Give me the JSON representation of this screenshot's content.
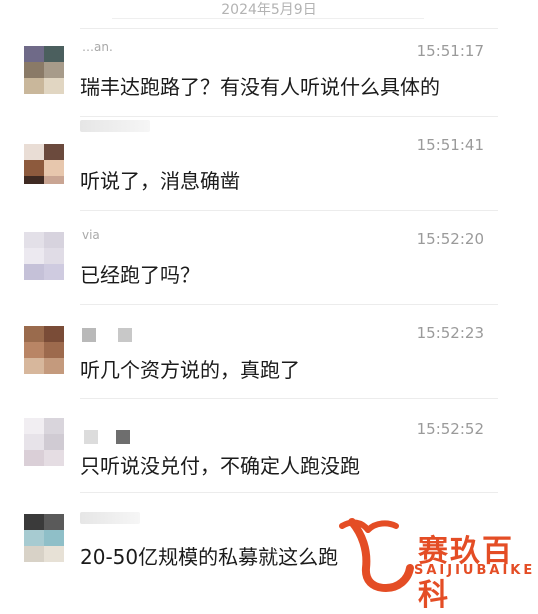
{
  "chat": {
    "date": "2024年5月9日",
    "messages": [
      {
        "name": "…an.",
        "time": "15:51:17",
        "text": "瑞丰达跑路了？有没有人听说什么具体的"
      },
      {
        "name": "",
        "time": "15:51:41",
        "text": "听说了，消息确凿"
      },
      {
        "name": "via",
        "time": "15:52:20",
        "text": "已经跑了吗？"
      },
      {
        "name": "",
        "time": "15:52:23",
        "text": "听几个资方说的，真跑了"
      },
      {
        "name": "",
        "time": "15:52:52",
        "text": "只听说没兑付，不确定人跑没跑"
      },
      {
        "name": "",
        "time": "",
        "text": "20-50亿规模的私募就这么跑"
      }
    ]
  },
  "watermark": {
    "title": "赛玖百科",
    "subtitle": "SAIJIUBAIKE",
    "color": "#e44d25"
  }
}
